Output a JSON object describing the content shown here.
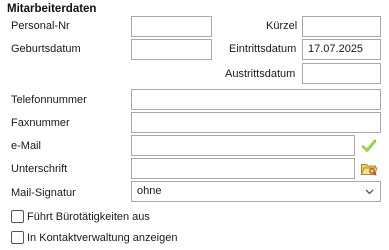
{
  "section": {
    "title": "Mitarbeiterdaten"
  },
  "fields": {
    "personal_nr": {
      "label": "Personal-Nr",
      "value": ""
    },
    "kuerzel": {
      "label": "Kürzel",
      "value": ""
    },
    "geburtsdatum": {
      "label": "Geburtsdatum",
      "value": ""
    },
    "eintrittsdatum": {
      "label": "Eintrittsdatum",
      "value": "17.07.2025"
    },
    "austrittsdatum": {
      "label": "Austrittsdatum",
      "value": ""
    },
    "telefonnummer": {
      "label": "Telefonnummer",
      "value": ""
    },
    "faxnummer": {
      "label": "Faxnummer",
      "value": ""
    },
    "email": {
      "label": "e-Mail",
      "value": ""
    },
    "unterschrift": {
      "label": "Unterschrift",
      "value": ""
    },
    "mail_signatur": {
      "label": "Mail-Signatur",
      "value": "ohne"
    }
  },
  "checkboxes": {
    "buero": {
      "label": "Führt Bürotätigkeiten aus",
      "checked": false
    },
    "kontakt": {
      "label": "In Kontaktverwaltung anzeigen",
      "checked": false
    }
  },
  "icons": {
    "email_check": "check-icon",
    "unterschrift_browse": "folder-icon",
    "dropdown": "chevron-down-icon"
  },
  "colors": {
    "check_green": "#7cc31f",
    "folder_yellow": "#f2cd5c"
  }
}
